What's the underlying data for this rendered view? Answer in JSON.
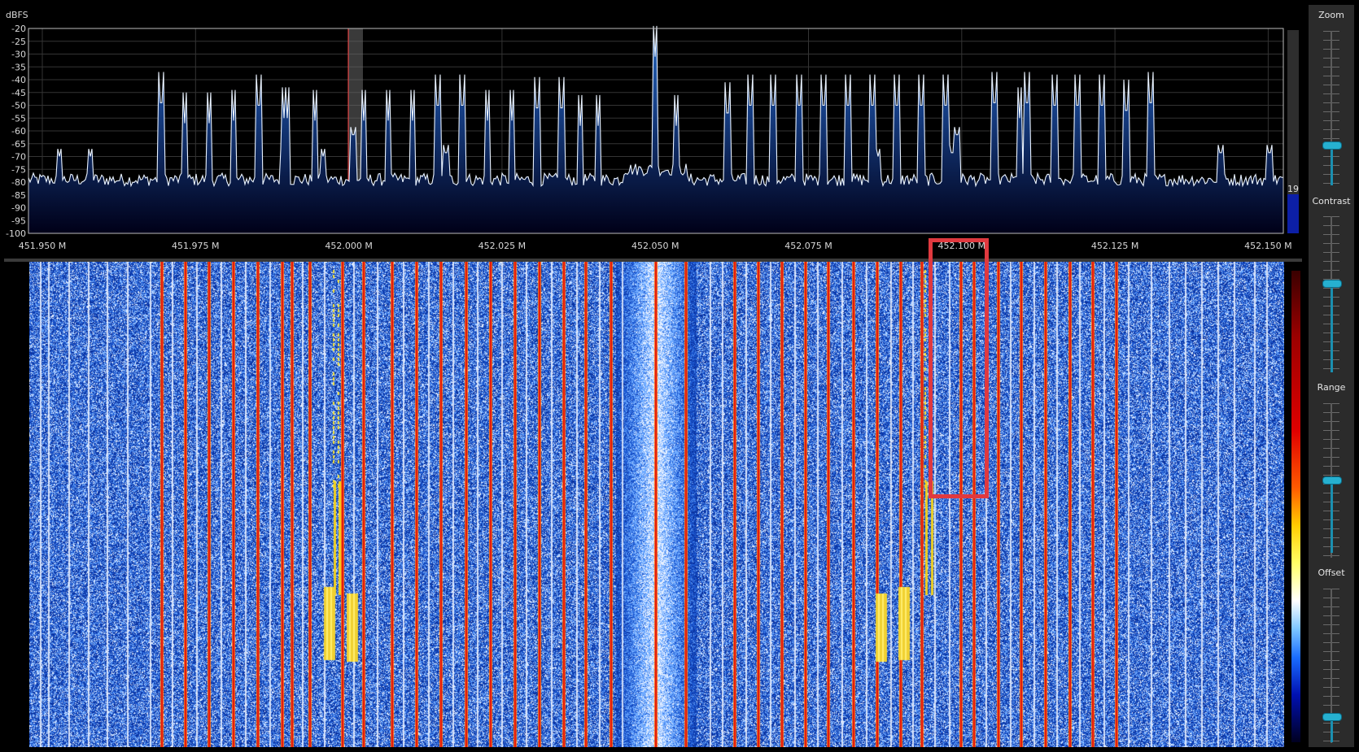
{
  "spectrum": {
    "unit_label": "dBFS",
    "y_ticks": [
      "-20",
      "-25",
      "-30",
      "-35",
      "-40",
      "-45",
      "-50",
      "-55",
      "-60",
      "-65",
      "-70",
      "-75",
      "-80",
      "-85",
      "-90",
      "-95",
      "-100"
    ],
    "x_ticks": [
      "451.950 M",
      "451.975 M",
      "452.000 M",
      "452.025 M",
      "452.050 M",
      "452.075 M",
      "452.100 M",
      "452.125 M",
      "452.150 M"
    ],
    "level_value": "19",
    "colors": {
      "trace": "#e8f2ff",
      "fill_top": "#1d5aa8",
      "fill_bottom": "#000010",
      "grid": "#3a3a3a",
      "frame": "#bdbdbd",
      "vfo": "#ff4040"
    }
  },
  "controls": {
    "zoom_label": "Zoom",
    "contrast_label": "Contrast",
    "range_label": "Range",
    "offset_label": "Offset"
  },
  "colors": {
    "waterfall_background": "#0a3fae",
    "accent": "#26b0d0",
    "highlight": "#e0393f"
  }
}
